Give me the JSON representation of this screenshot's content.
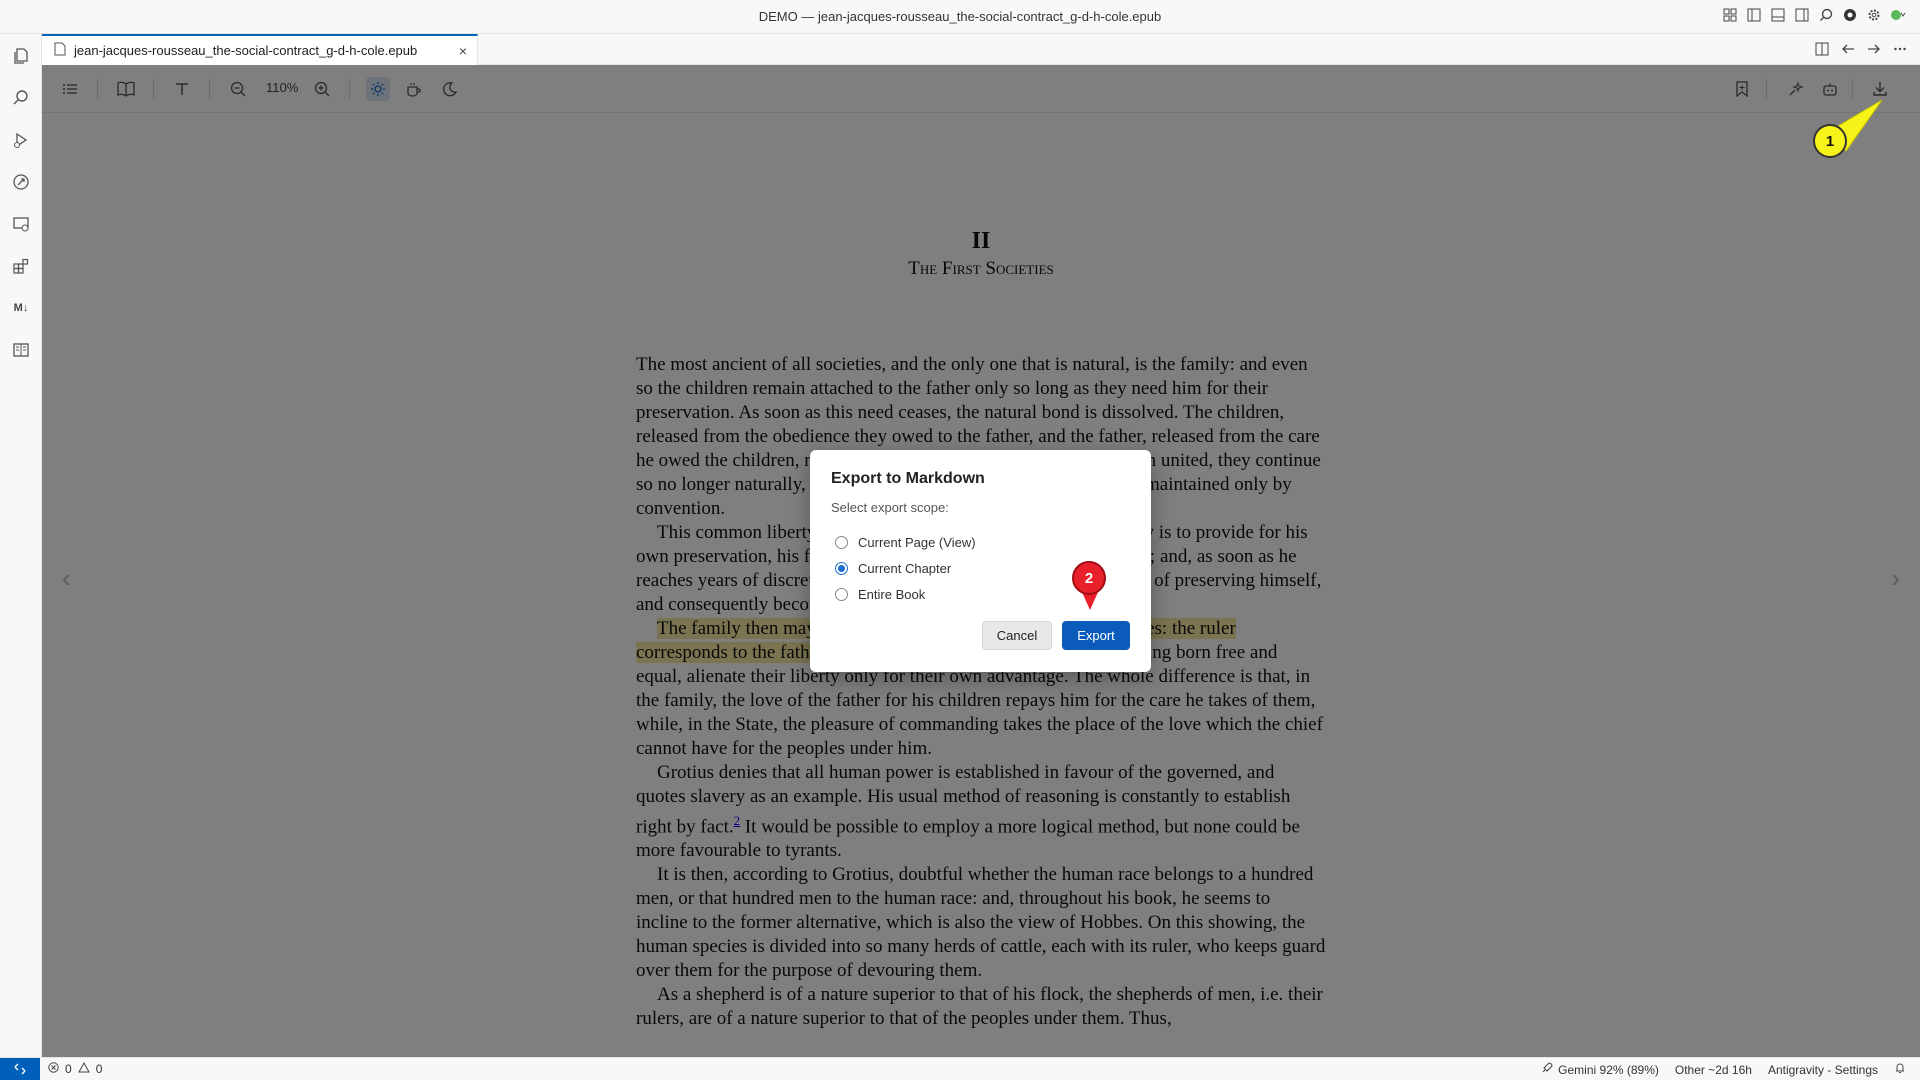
{
  "window": {
    "title": "DEMO — jean-jacques-rousseau_the-social-contract_g-d-h-cole.epub"
  },
  "tab": {
    "label": "jean-jacques-rousseau_the-social-contract_g-d-h-cole.epub",
    "close_glyph": "×"
  },
  "toolbar": {
    "zoom_level": "110%"
  },
  "content": {
    "chapter_number": "II",
    "chapter_title": "The First Societies",
    "p1": "The most ancient of all societies, and the only one that is natural, is the family: and even so the children remain attached to the father only so long as they need him for their preservation. As soon as this need ceases, the natural bond is dissolved. The children, released from the obedience they owed to the father, and the father, released from the care he owed the children, return equally to independence. If they remain united, they continue so no longer naturally, but voluntarily; and the family itself is then maintained only by convention.",
    "p2": "This common liberty results from the nature of man. His first law is to provide for his own preservation, his first cares are those which he owes to himself; and, as soon as he reaches years of discretion, he is the sole judge of the proper means of preserving himself, and consequently becomes his own master.",
    "p3_highlight": "The family then may be called the first model of political societies: the ruler corresponds to the father, and the people to the children;",
    "p3_rest": " and all, being born free and equal, alienate their liberty only for their own advantage. The whole difference is that, in the family, the love of the father for his children repays him for the care he takes of them, while, in the State, the pleasure of commanding takes the place of the love which the chief cannot have for the peoples under him.",
    "p4_a": "Grotius denies that all human power is established in favour of the governed, and quotes slavery as an example. His usual method of reasoning is constantly to establish right by fact.",
    "p4_sup": "2",
    "p4_b": " It would be possible to employ a more logical method, but none could be more favourable to tyrants.",
    "p5": "It is then, according to Grotius, doubtful whether the human race belongs to a hundred men, or that hundred men to the human race: and, throughout his book, he seems to incline to the former alternative, which is also the view of Hobbes. On this showing, the human species is divided into so many herds of cattle, each with its ruler, who keeps guard over them for the purpose of devouring them.",
    "p6": "As a shepherd is of a nature superior to that of his flock, the shepherds of men, i.e. their rulers, are of a nature superior to that of the peoples under them. Thus,",
    "prev_glyph": "‹",
    "next_glyph": "›"
  },
  "dialog": {
    "title": "Export to Markdown",
    "subtitle": "Select export scope:",
    "options": [
      {
        "label": "Current Page (View)",
        "checked": false
      },
      {
        "label": "Current Chapter",
        "checked": true
      },
      {
        "label": "Entire Book",
        "checked": false
      }
    ],
    "cancel_label": "Cancel",
    "export_label": "Export"
  },
  "annotations": {
    "marker1": "1",
    "marker2": "2",
    "marker1_color": "#f7f218",
    "marker2_color": "#e8202a"
  },
  "statusbar": {
    "errors": "0",
    "warnings": "0",
    "gemini": "Gemini 92% (89%)",
    "other": "Other ~2d 16h",
    "settings": "Antigravity - Settings"
  },
  "colors": {
    "accent": "#005fb8",
    "export_button": "#0b5cba",
    "highlight": "#f5e8a3"
  }
}
